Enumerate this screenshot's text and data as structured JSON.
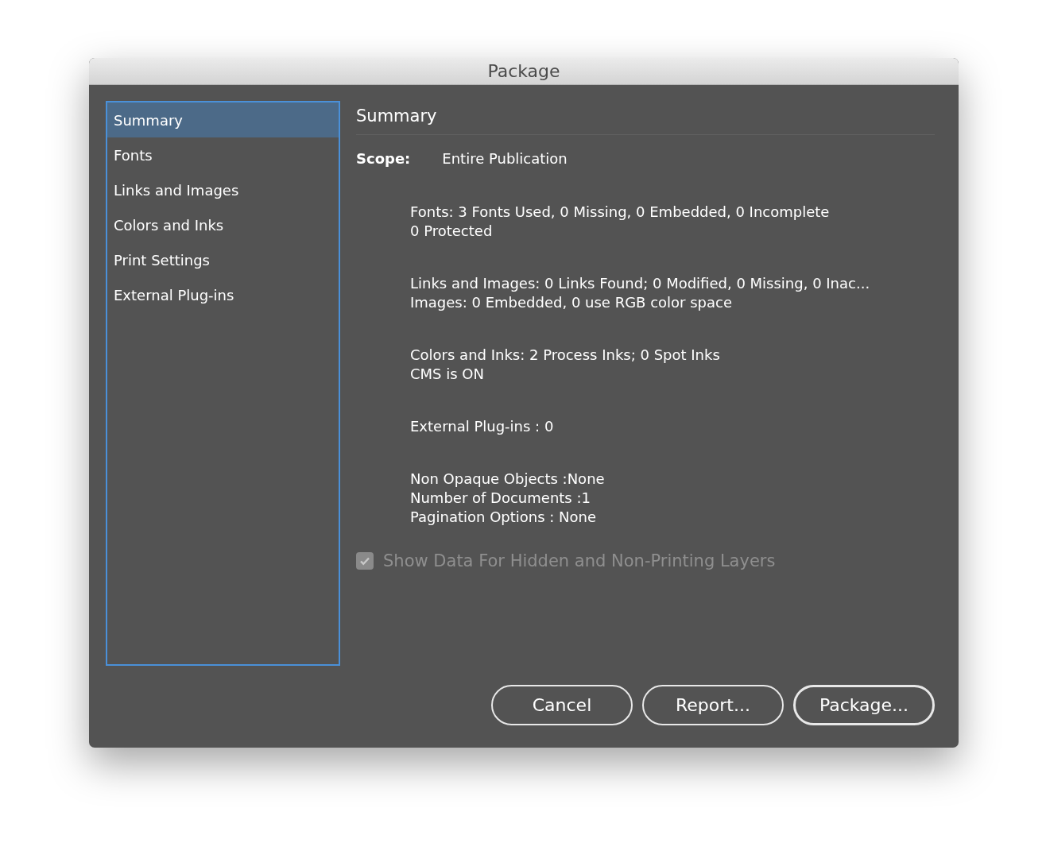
{
  "window": {
    "title": "Package"
  },
  "sidebar": {
    "items": [
      {
        "label": "Summary",
        "selected": true
      },
      {
        "label": "Fonts",
        "selected": false
      },
      {
        "label": "Links and Images",
        "selected": false
      },
      {
        "label": "Colors and Inks",
        "selected": false
      },
      {
        "label": "Print Settings",
        "selected": false
      },
      {
        "label": "External Plug-ins",
        "selected": false
      }
    ]
  },
  "summary": {
    "heading": "Summary",
    "scope_label": "Scope:",
    "scope_value": "Entire Publication",
    "sections": [
      {
        "lines": [
          "Fonts: 3 Fonts Used, 0 Missing, 0 Embedded, 0 Incomplete",
          "0 Protected"
        ]
      },
      {
        "lines": [
          "Links and Images: 0 Links Found; 0 Modified, 0 Missing, 0 Inac...",
          "Images: 0 Embedded, 0 use RGB color space"
        ]
      },
      {
        "lines": [
          "Colors and Inks: 2 Process Inks; 0 Spot Inks",
          "CMS is ON"
        ]
      },
      {
        "lines": [
          "External Plug-ins : 0"
        ]
      },
      {
        "lines": [
          "Non Opaque Objects :None",
          "Number of Documents :1",
          "Pagination Options : None"
        ]
      }
    ]
  },
  "checkbox": {
    "label": "Show Data For Hidden and Non-Printing Layers",
    "checked": true,
    "disabled": true
  },
  "buttons": [
    {
      "label": "Cancel",
      "default": false
    },
    {
      "label": "Report...",
      "default": false
    },
    {
      "label": "Package...",
      "default": true
    }
  ]
}
